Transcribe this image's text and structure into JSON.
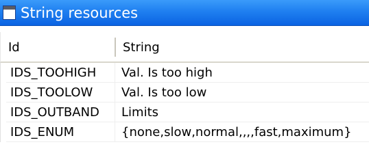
{
  "window": {
    "title": "String resources",
    "icon": "window-icon"
  },
  "table": {
    "columns": [
      "Id",
      "String"
    ],
    "rows": [
      {
        "id": "IDS_TOOHIGH",
        "string": "Val. Is too high"
      },
      {
        "id": "IDS_TOOLOW",
        "string": "Val. Is too low"
      },
      {
        "id": "IDS_OUTBAND",
        "string": "Limits"
      },
      {
        "id": "IDS_ENUM",
        "string": "{none,slow,normal,,,,fast,maximum}"
      }
    ]
  },
  "colors": {
    "titlebar": "#1f7ff0",
    "title_text": "#ffffff",
    "background": "#ffffff"
  }
}
